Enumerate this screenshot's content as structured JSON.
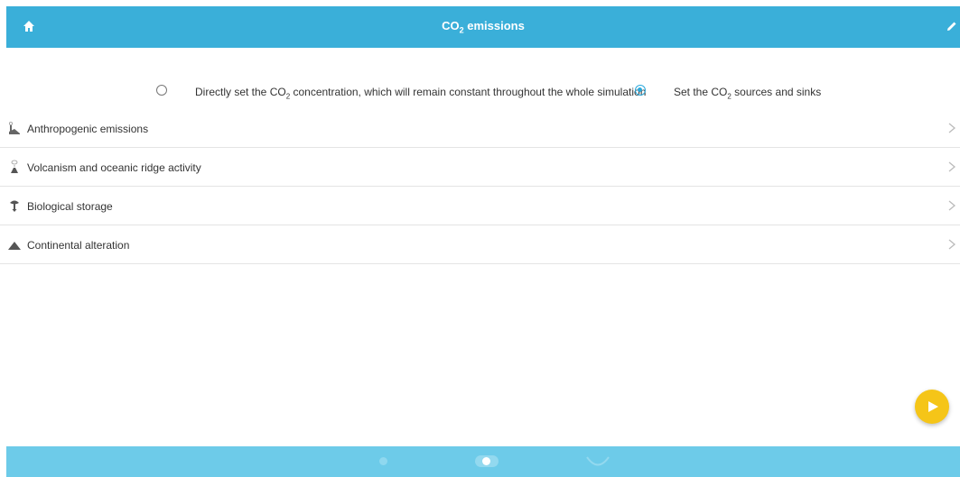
{
  "header": {
    "home_icon": "home-icon",
    "title_prefix": "CO",
    "title_sub": "2",
    "title_suffix": " emissions",
    "edit_icon": "pencil-icon",
    "background_color": "#3aafd9"
  },
  "mode_options": [
    {
      "label_prefix": "Directly set the CO",
      "label_sub": "2",
      "label_suffix": " concentration, which will remain constant throughout the whole simulation",
      "selected": false
    },
    {
      "label_prefix": "Set the CO",
      "label_sub": "2",
      "label_suffix": " sources and sinks",
      "selected": true
    }
  ],
  "list": {
    "items": [
      {
        "label": "Anthropogenic emissions",
        "icon": "factory-icon"
      },
      {
        "label": "Volcanism and oceanic ridge activity",
        "icon": "volcano-icon"
      },
      {
        "label": "Biological storage",
        "icon": "tree-icon"
      },
      {
        "label": "Continental alteration",
        "icon": "mountain-icon"
      }
    ]
  },
  "fab": {
    "icon": "play-icon",
    "color": "#f5c518"
  },
  "footer": {
    "background_color": "#6dcbe9",
    "controls": [
      "dot-icon",
      "toggle-switch",
      "spinner-icon"
    ]
  }
}
